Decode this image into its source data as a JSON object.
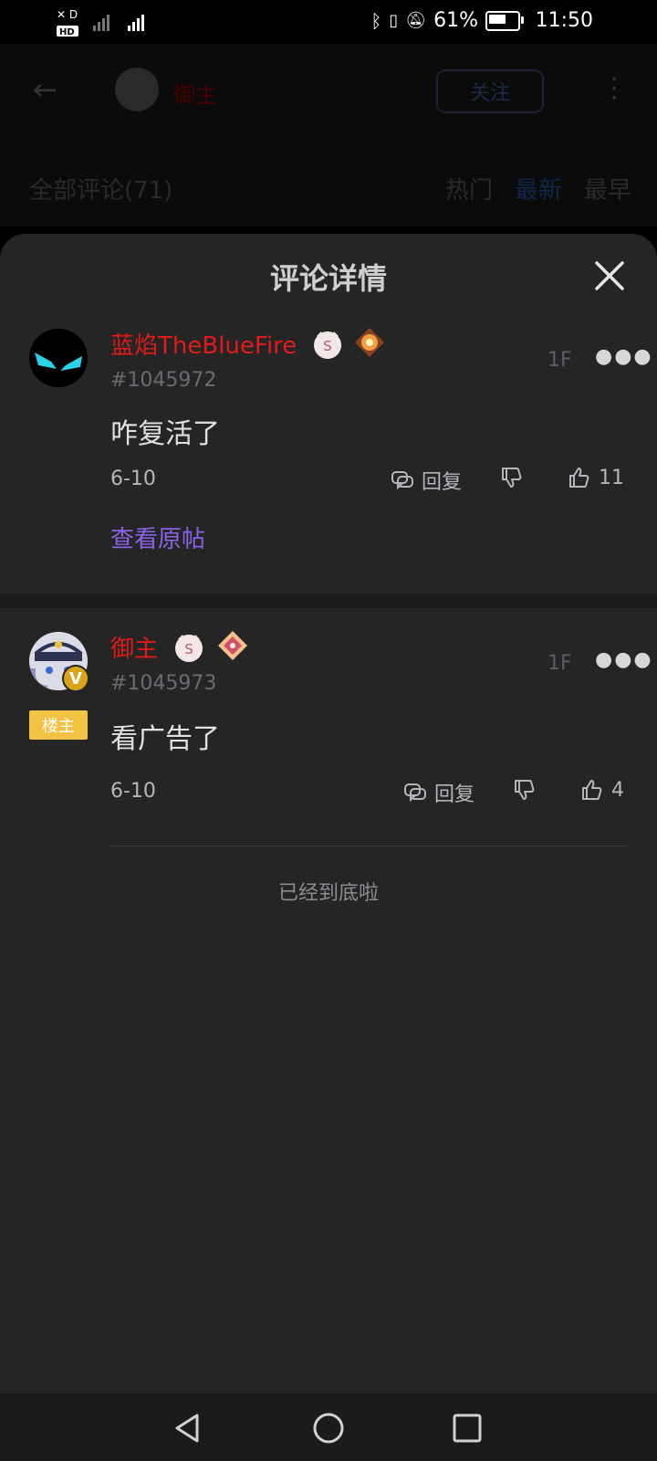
{
  "status_bar": {
    "left_indicators": "HD 4G",
    "battery": "61%",
    "battery_level": 0.61,
    "time": "11:50"
  },
  "background": {
    "author_name": "御主",
    "follow_label": "关注",
    "all_comments": "全部评论(71)",
    "sort_tabs": [
      "热门",
      "最新",
      "最早"
    ]
  },
  "sheet": {
    "title": "评论详情",
    "end_text": "已经到底啦"
  },
  "comments": [
    {
      "username": "蓝焰TheBlueFire",
      "uid": "#1045972",
      "floor": "1F",
      "content": "咋复活了",
      "date": "6-10",
      "reply_label": "回复",
      "likes": "11",
      "view_origin": "查看原帖"
    },
    {
      "username": "御主",
      "uid": "#1045973",
      "floor": "1F",
      "owner_tag": "楼主",
      "content": "看广告了",
      "date": "6-10",
      "reply_label": "回复",
      "likes": "4"
    }
  ],
  "colors": {
    "username": "#e11a1a",
    "link": "#8b63e6",
    "owner_tag": "#f2c244",
    "sheet_bg": "#252525"
  }
}
